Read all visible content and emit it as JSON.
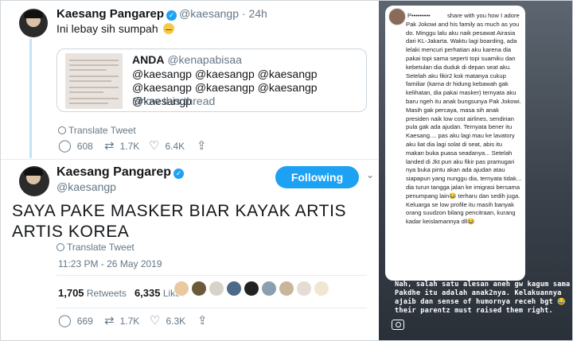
{
  "tweet1": {
    "name": "Kaesang Pangarep",
    "handle": "@kaesangp",
    "time": "· 24h",
    "text": "Ini lebay sih sumpah",
    "quote": {
      "name": "ANDA",
      "handle": "@kenapabisaa",
      "text": "@kaesangp @kaesangp @kaesangp @kaesangp @kaesangp @kaesangp @kaesangp",
      "show": "Show this thread"
    },
    "translate": "Translate Tweet",
    "actions": {
      "reply": "608",
      "retweet": "1.7K",
      "like": "6.4K"
    }
  },
  "tweet2": {
    "name": "Kaesang Pangarep",
    "handle": "@kaesangp",
    "follow_label": "Following",
    "text": "SAYA PAKE MASKER BIAR KAYAK ARTIS ARTIS KOREA",
    "translate": "Translate Tweet",
    "timestamp": "11:23 PM - 26 May 2019",
    "retweets": "1,705",
    "retweets_label": "Retweets",
    "likes": "6,335",
    "likes_label": "Likes",
    "actions": {
      "reply": "669",
      "retweet": "1.7K",
      "like": "6.3K"
    },
    "liker_colors": [
      "#e8c9a0",
      "#6b5a3a",
      "#d9d2c8",
      "#4c6a8a",
      "#222222",
      "#8aa0b0",
      "#c9b59a",
      "#e3ddd4",
      "#f0e6d2"
    ]
  },
  "story": {
    "username": "P•••••••••",
    "text": "share with you how I adore Pak Jokowi and his family as much as you do. Minggu lalu aku naik pesawat Airasia dari KL-Jakarta. Waktu lagi boarding, ada lelaki mencuri perhatian aku karena dia pakai topi sama seperti topi suamiku dan kebetulan dia duduk di depan seat aku. Setelah aku fikir2 kok matanya cukup familiar (karna dr hidung kebawah gak kelihatan, dia pakai masker) ternyata aku baru ngeh itu anak bungsunya Pak Jokowi. Masih gak percaya, masa sih anak presiden naik low cost airlines, sendirian pula gak ada ajudan. Ternyata bener itu Kaesang.... pas aku lagi mau ke lavatory aku liat dia lagi solat di seat, abis itu makan buka puasa seadanya... Setelah landed di Jkt pun aku fikir pas pramugari nya buka pintu akan ada ajudan atau siapapun yang nunggu dia, ternyata tidak... dia turun tangga jalan ke imigrasi bersama penumpang lain😂 terharu dan sedih juga. Keluarga se low profile itu masih banyak orang suudzon bilang pencitraan, kurang kadar keislamannya dll😂",
    "overlay": "Nah, salah satu alesan aneh gw kagum sama Pakdhe itu adalah anak2nya. Kelakuannya ajaib dan sense of humornya receh bgt 😂 their parentz must raised them right."
  },
  "colors": {
    "accent": "#1da1f2",
    "muted": "#657786"
  },
  "icons": {
    "reply": "reply-icon",
    "retweet": "retweet-icon",
    "like": "heart-icon",
    "globe": "globe-icon",
    "verified": "verified-badge-icon",
    "camera": "camera-icon"
  }
}
